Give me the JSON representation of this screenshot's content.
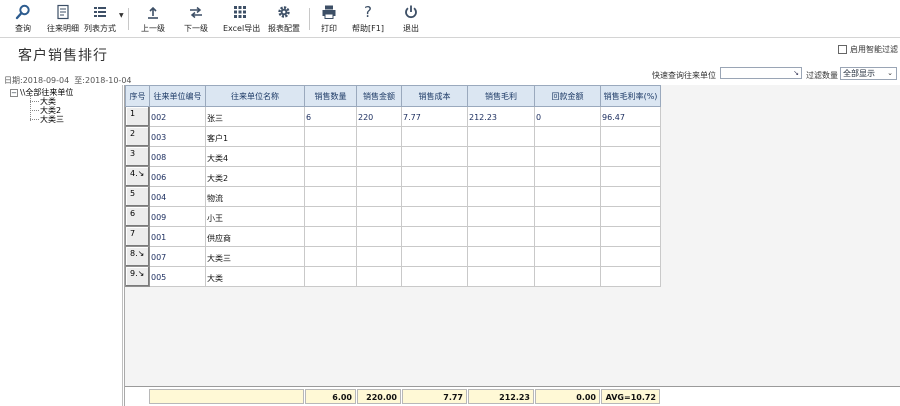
{
  "toolbar": {
    "items": [
      {
        "label": "查询",
        "icon": "search-icon"
      },
      {
        "label": "往来明细",
        "icon": "document-icon"
      },
      {
        "label": "列表方式",
        "icon": "list-view-icon"
      },
      {
        "label": "上一级",
        "icon": "level-up-icon"
      },
      {
        "label": "下一级",
        "icon": "level-down-icon"
      },
      {
        "label": "Excel导出",
        "icon": "excel-export-icon"
      },
      {
        "label": "报表配置",
        "icon": "gear-icon"
      },
      {
        "label": "打印",
        "icon": "printer-icon"
      },
      {
        "label": "帮助[F1]",
        "icon": "help-icon"
      },
      {
        "label": "退出",
        "icon": "power-icon"
      }
    ]
  },
  "page": {
    "title": "客户销售排行",
    "date_label": "日期:",
    "date_from": "2018-09-04",
    "date_to_label": "至:",
    "date_to": "2018-10-04"
  },
  "smart_filter": {
    "label": "启用智能过滤",
    "checked": false
  },
  "quick_query": {
    "label": "快速查询往来单位",
    "value": ""
  },
  "filter_count": {
    "label": "过滤数量",
    "selected": "全部显示"
  },
  "tree": {
    "root": "\\\\全部往来单位",
    "children": [
      "大类",
      "大类2",
      "大类三"
    ]
  },
  "grid": {
    "columns": [
      "序号",
      "往来单位编号",
      "往来单位名称",
      "销售数量",
      "销售金额",
      "销售成本",
      "销售毛利",
      "回款金额",
      "销售毛利率(%)"
    ],
    "rows": [
      {
        "num": "1",
        "code": "002",
        "name": "张三",
        "qty": "6",
        "amount": "220",
        "cost": "7.77",
        "profit": "212.23",
        "received": "0",
        "rate": "96.47"
      },
      {
        "num": "2",
        "code": "003",
        "name": "客户1",
        "qty": "",
        "amount": "",
        "cost": "",
        "profit": "",
        "received": "",
        "rate": ""
      },
      {
        "num": "3",
        "code": "008",
        "name": "大类4",
        "qty": "",
        "amount": "",
        "cost": "",
        "profit": "",
        "received": "",
        "rate": ""
      },
      {
        "num": "4.↘",
        "code": "006",
        "name": "大类2",
        "qty": "",
        "amount": "",
        "cost": "",
        "profit": "",
        "received": "",
        "rate": ""
      },
      {
        "num": "5",
        "code": "004",
        "name": "物流",
        "qty": "",
        "amount": "",
        "cost": "",
        "profit": "",
        "received": "",
        "rate": ""
      },
      {
        "num": "6",
        "code": "009",
        "name": "小王",
        "qty": "",
        "amount": "",
        "cost": "",
        "profit": "",
        "received": "",
        "rate": ""
      },
      {
        "num": "7",
        "code": "001",
        "name": "供应商",
        "qty": "",
        "amount": "",
        "cost": "",
        "profit": "",
        "received": "",
        "rate": ""
      },
      {
        "num": "8.↘",
        "code": "007",
        "name": "大类三",
        "qty": "",
        "amount": "",
        "cost": "",
        "profit": "",
        "received": "",
        "rate": ""
      },
      {
        "num": "9.↘",
        "code": "005",
        "name": "大类",
        "qty": "",
        "amount": "",
        "cost": "",
        "profit": "",
        "received": "",
        "rate": ""
      }
    ],
    "totals": {
      "qty": "6.00",
      "amount": "220.00",
      "cost": "7.77",
      "profit": "212.23",
      "received": "0.00",
      "rate": "AVG=10.72"
    }
  },
  "colors": {
    "header_bg": "#dbe6f2",
    "header_text": "#1d3a66",
    "totals_bg": "#fff9d6"
  }
}
